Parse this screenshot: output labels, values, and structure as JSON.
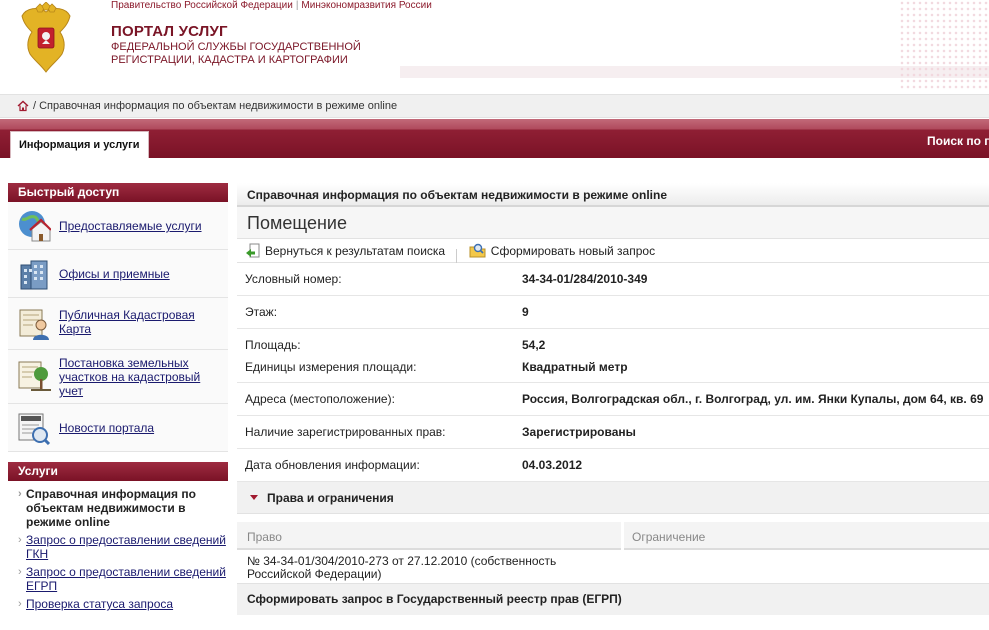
{
  "header": {
    "top_link_gov": "Правительство Российской Федерации",
    "top_link_sep": "|",
    "top_link_min": "Минэкономразвития России",
    "title": "ПОРТАЛ УСЛУГ",
    "subtitle_line1": "ФЕДЕРАЛЬНОЙ СЛУЖБЫ ГОСУДАРСТВЕННОЙ",
    "subtitle_line2": "РЕГИСТРАЦИИ, КАДАСТРА И КАРТОГРАФИИ"
  },
  "breadcrumb": {
    "text": "/ Справочная информация по объектам недвижимости в режиме online"
  },
  "nav": {
    "tab_label": "Информация и услуги",
    "right_label": "Поиск по п"
  },
  "sidebar": {
    "quick_header": "Быстрый доступ",
    "quick_items": [
      {
        "label": "Предоставляемые услуги",
        "icon": "globe-house-icon"
      },
      {
        "label": "Офисы и приемные",
        "icon": "office-building-icon"
      },
      {
        "label": "Публичная Кадастровая Карта",
        "icon": "cadastral-map-icon"
      },
      {
        "label": "Постановка земельных участков на кадастровый учет",
        "icon": "land-plot-icon"
      },
      {
        "label": "Новости портала",
        "icon": "news-icon"
      }
    ],
    "services_header": "Услуги",
    "services": [
      {
        "label": "Справочная информация по объектам недвижимости в режиме online"
      },
      {
        "label": "Запрос о предоставлении сведений ГКН"
      },
      {
        "label": "Запрос о предоставлении сведений ЕГРП"
      },
      {
        "label": "Проверка статуса запроса"
      }
    ]
  },
  "main": {
    "title": "Справочная информация по объектам недвижимости в режиме online",
    "section_title": "Помещение",
    "actions": {
      "back": "Вернуться к результатам поиска",
      "new_request": "Сформировать новый запрос"
    },
    "fields": [
      {
        "label": "Условный номер:",
        "value": "34-34-01/284/2010-349"
      },
      {
        "label": "Этаж:",
        "value": "9"
      },
      {
        "label": "Площадь:",
        "value": "54,2"
      },
      {
        "label": "Единицы измерения площади:",
        "value": "Квадратный метр"
      },
      {
        "label": "Адреса (местоположение):",
        "value": "Россия, Волгоградская обл., г. Волгоград, ул. им. Янки Купалы, дом 64, кв. 69"
      },
      {
        "label": "Наличие зарегистрированных прав:",
        "value": "Зарегистрированы"
      },
      {
        "label": "Дата обновления информации:",
        "value": "04.03.2012"
      }
    ],
    "rights": {
      "header": "Права и ограничения",
      "col_right": "Право",
      "col_restriction": "Ограничение",
      "row_line1": "№ 34-34-01/304/2010-273  от 27.12.2010  (собственность",
      "row_line2": "Российской Федерации)"
    },
    "request_bar": "Сформировать запрос в Государственный реестр прав (ЕГРП)"
  },
  "colors": {
    "brand": "#7a1226",
    "link": "#1a1a6e"
  }
}
